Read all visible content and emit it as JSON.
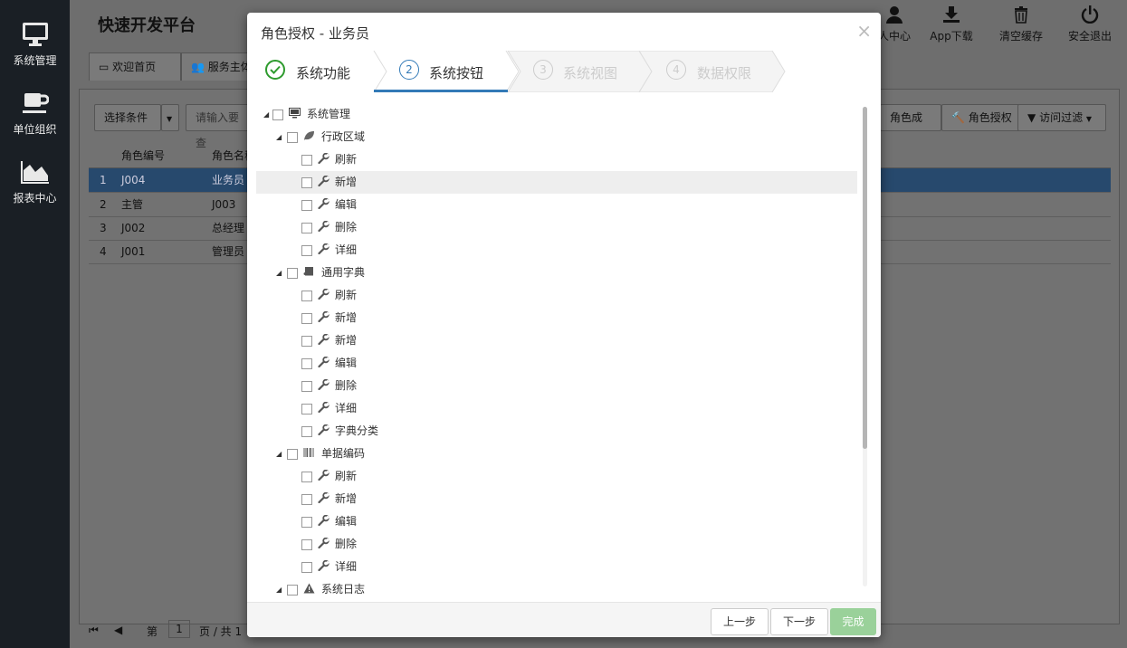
{
  "sidebar": {
    "items": [
      {
        "label": "系统管理",
        "icon": "monitor-icon"
      },
      {
        "label": "单位组织",
        "icon": "coffee-icon"
      },
      {
        "label": "报表中心",
        "icon": "area-chart-icon"
      }
    ]
  },
  "app": {
    "title": "快速开发平台",
    "tabs": [
      "欢迎首页",
      "服务主体"
    ],
    "top_buttons": [
      {
        "label": "人中心",
        "icon": "user-icon"
      },
      {
        "label": "App下载",
        "icon": "download-icon"
      },
      {
        "label": "清空缓存",
        "icon": "trash-icon"
      },
      {
        "label": "安全退出",
        "icon": "power-icon"
      }
    ],
    "toolbar": {
      "select_condition": "选择条件",
      "search_placeholder": "请输入要查",
      "role_members": "角色成员",
      "role_auth": "角色授权",
      "access_filter": "访问过滤"
    },
    "grid": {
      "headers": [
        "角色编号",
        "角色名称"
      ],
      "rows": [
        {
          "no": "1",
          "code": "J004",
          "name": "业务员"
        },
        {
          "no": "2",
          "code": "主管",
          "name": "J003"
        },
        {
          "no": "3",
          "code": "J002",
          "name": "总经理"
        },
        {
          "no": "4",
          "code": "J001",
          "name": "管理员"
        }
      ]
    },
    "pager": {
      "page_label": "第",
      "page_value": "1",
      "page_of": "页 / 共 1"
    }
  },
  "modal": {
    "title": "角色授权 - 业务员",
    "close": "×",
    "steps": [
      {
        "num": "",
        "label": "系统功能",
        "state": "done"
      },
      {
        "num": "2",
        "label": "系统按钮",
        "state": "active"
      },
      {
        "num": "3",
        "label": "系统视图",
        "state": "pending"
      },
      {
        "num": "4",
        "label": "数据权限",
        "state": "pending"
      }
    ],
    "tree": [
      {
        "level": 0,
        "expand": true,
        "icon": "monitor-icon",
        "label": "系统管理"
      },
      {
        "level": 1,
        "expand": true,
        "icon": "leaf-icon",
        "label": "行政区域"
      },
      {
        "level": 2,
        "icon": "wrench-icon",
        "label": "刷新"
      },
      {
        "level": 2,
        "icon": "wrench-icon",
        "label": "新增",
        "hover": true
      },
      {
        "level": 2,
        "icon": "wrench-icon",
        "label": "编辑"
      },
      {
        "level": 2,
        "icon": "wrench-icon",
        "label": "删除"
      },
      {
        "level": 2,
        "icon": "wrench-icon",
        "label": "详细"
      },
      {
        "level": 1,
        "expand": true,
        "icon": "book-icon",
        "label": "通用字典"
      },
      {
        "level": 2,
        "icon": "wrench-icon",
        "label": "刷新"
      },
      {
        "level": 2,
        "icon": "wrench-icon",
        "label": "新增"
      },
      {
        "level": 2,
        "icon": "wrench-icon",
        "label": "新增"
      },
      {
        "level": 2,
        "icon": "wrench-icon",
        "label": "编辑"
      },
      {
        "level": 2,
        "icon": "wrench-icon",
        "label": "删除"
      },
      {
        "level": 2,
        "icon": "wrench-icon",
        "label": "详细"
      },
      {
        "level": 2,
        "icon": "wrench-icon",
        "label": "字典分类"
      },
      {
        "level": 1,
        "expand": true,
        "icon": "barcode-icon",
        "label": "单据编码"
      },
      {
        "level": 2,
        "icon": "wrench-icon",
        "label": "刷新"
      },
      {
        "level": 2,
        "icon": "wrench-icon",
        "label": "新增"
      },
      {
        "level": 2,
        "icon": "wrench-icon",
        "label": "编辑"
      },
      {
        "level": 2,
        "icon": "wrench-icon",
        "label": "删除"
      },
      {
        "level": 2,
        "icon": "wrench-icon",
        "label": "详细"
      },
      {
        "level": 1,
        "expand": true,
        "icon": "warning-icon",
        "label": "系统日志"
      }
    ],
    "footer": {
      "prev": "上一步",
      "next": "下一步",
      "finish": "完成"
    }
  }
}
